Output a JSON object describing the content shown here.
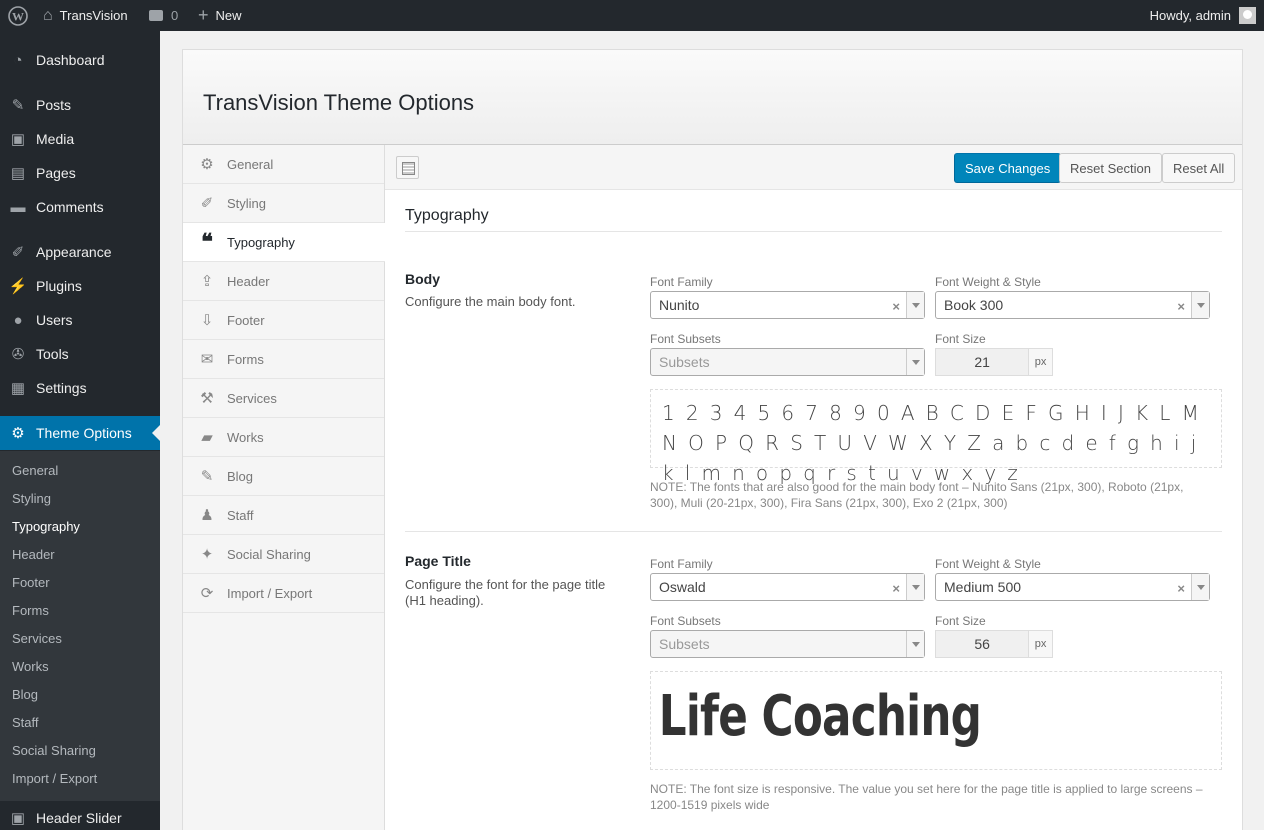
{
  "adminbar": {
    "site_name": "TransVision",
    "comments_count": "0",
    "new_label": "New",
    "howdy": "Howdy, admin"
  },
  "sidebar": {
    "items": [
      {
        "label": "Dashboard",
        "icon": "dashboard-icon"
      },
      {
        "label": "Posts",
        "icon": "pin-icon"
      },
      {
        "label": "Media",
        "icon": "media-icon"
      },
      {
        "label": "Pages",
        "icon": "pages-icon"
      },
      {
        "label": "Comments",
        "icon": "comment-icon"
      },
      {
        "label": "Appearance",
        "icon": "brush-icon"
      },
      {
        "label": "Plugins",
        "icon": "plugin-icon"
      },
      {
        "label": "Users",
        "icon": "user-icon"
      },
      {
        "label": "Tools",
        "icon": "wrench-icon"
      },
      {
        "label": "Settings",
        "icon": "settings-icon"
      },
      {
        "label": "Theme Options",
        "icon": "gear-icon"
      }
    ],
    "submenu": [
      "General",
      "Styling",
      "Typography",
      "Header",
      "Footer",
      "Forms",
      "Services",
      "Works",
      "Blog",
      "Staff",
      "Social Sharing",
      "Import / Export"
    ],
    "last_item": "Header Slider"
  },
  "panel": {
    "title": "TransVision Theme Options",
    "tabs": [
      "General",
      "Styling",
      "Typography",
      "Header",
      "Footer",
      "Forms",
      "Services",
      "Works",
      "Blog",
      "Staff",
      "Social Sharing",
      "Import / Export"
    ],
    "active_tab": "Typography",
    "buttons": {
      "save": "Save Changes",
      "reset_section": "Reset Section",
      "reset_all": "Reset All"
    }
  },
  "section": {
    "title": "Typography",
    "body": {
      "title": "Body",
      "desc": "Configure the main body font.",
      "font_family_label": "Font Family",
      "font_family": "Nunito",
      "weight_label": "Font Weight & Style",
      "weight": "Book 300",
      "subsets_label": "Font Subsets",
      "subsets_placeholder": "Subsets",
      "size_label": "Font Size",
      "size": "21",
      "unit": "px",
      "preview": "1 2 3 4 5 6 7 8 9 0 A B C D E F G H I J K L M N O P Q R S T U V W X Y Z a b c d e f g h i j k l m n o p q r s t u v w x y z",
      "note": "NOTE: The fonts that are also good for the main body font – Nunito Sans (21px, 300), Roboto (21px, 300), Muli (20-21px, 300), Fira Sans (21px, 300), Exo 2 (21px, 300)"
    },
    "page_title": {
      "title": "Page Title",
      "desc": "Configure the font for the page title (H1 heading).",
      "font_family_label": "Font Family",
      "font_family": "Oswald",
      "weight_label": "Font Weight & Style",
      "weight": "Medium 500",
      "subsets_label": "Font Subsets",
      "subsets_placeholder": "Subsets",
      "size_label": "Font Size",
      "size": "56",
      "unit": "px",
      "preview": "Life Coaching",
      "note": "NOTE: The font size is responsive. The value you set here for the page title is applied to large screens – 1200-1519 pixels wide"
    }
  },
  "colors": {
    "admin_dark": "#23282d",
    "accent": "#0073aa",
    "primary_button": "#0085ba"
  }
}
